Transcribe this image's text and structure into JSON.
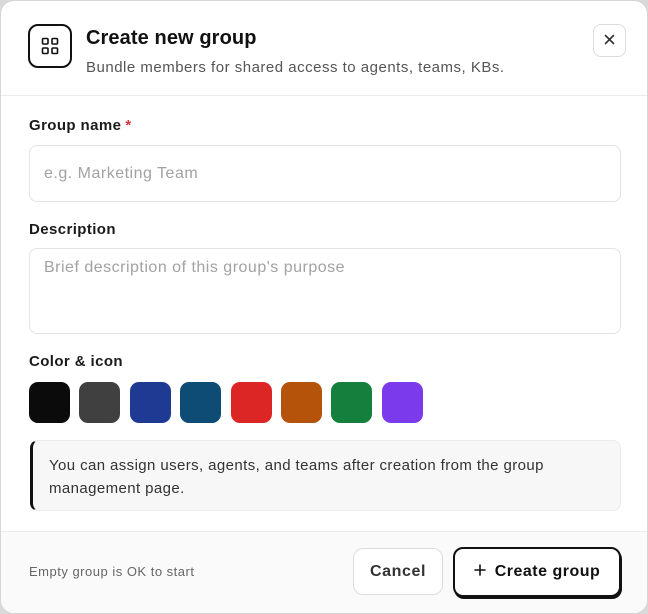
{
  "dialog": {
    "title": "Create new group",
    "subtitle": "Bundle members for shared access to agents, teams, KBs.",
    "header_icon": "grid-icon",
    "close_icon": "close-icon"
  },
  "form": {
    "name": {
      "label": "Group name",
      "required_mark": "*",
      "value": "",
      "placeholder": "e.g. Marketing Team"
    },
    "description": {
      "label": "Description",
      "value": "",
      "placeholder": "Brief description of this group's purpose"
    },
    "color": {
      "label": "Color & icon",
      "swatches": [
        "#0b0b0b",
        "#404040",
        "#1f3a93",
        "#0f4c75",
        "#dc2626",
        "#b45309",
        "#15803d",
        "#7c3aed"
      ]
    },
    "note": "You can assign users, agents, and teams after creation from the group management page."
  },
  "footer": {
    "hint": "Empty group is OK to start",
    "cancel_label": "Cancel",
    "create_label": "Create group",
    "create_icon": "plus-icon"
  }
}
